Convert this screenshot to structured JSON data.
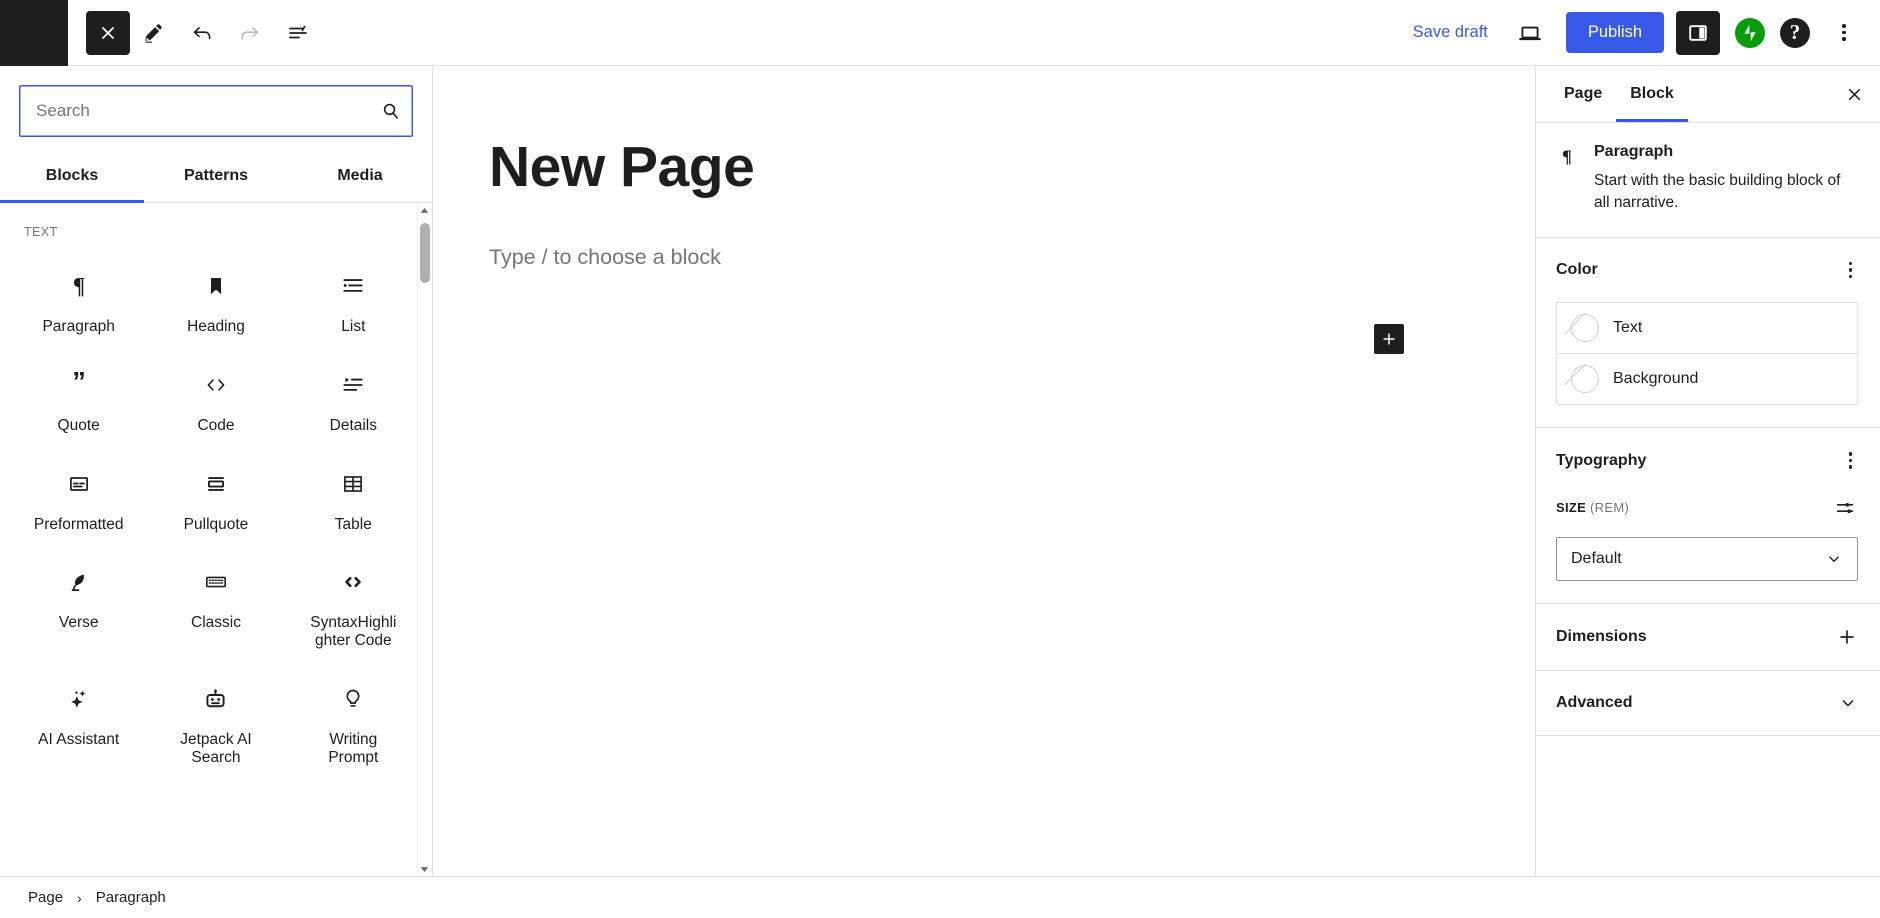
{
  "topbar": {
    "close_icon": "close-x-icon",
    "edit_icon": "pencil-edit-icon",
    "undo_icon": "undo-arrow-icon",
    "redo_icon": "redo-arrow-icon",
    "list_view_icon": "document-list-view-icon",
    "save_draft_label": "Save draft",
    "preview_icon": "desktop-preview-icon",
    "publish_label": "Publish",
    "settings_icon": "settings-sidebar-icon",
    "jetpack_icon": "jetpack-icon",
    "help_icon": "help-question-icon",
    "options_icon": "more-options-kebab-icon"
  },
  "inserter": {
    "search": {
      "value": "",
      "placeholder": "Search",
      "icon": "search-icon"
    },
    "tabs": [
      {
        "label": "Blocks",
        "active": true
      },
      {
        "label": "Patterns",
        "active": false
      },
      {
        "label": "Media",
        "active": false
      }
    ],
    "category_label": "TEXT",
    "blocks": [
      {
        "label": "Paragraph",
        "icon": "pilcrow-icon"
      },
      {
        "label": "Heading",
        "icon": "bookmark-heading-icon"
      },
      {
        "label": "List",
        "icon": "bullet-list-icon"
      },
      {
        "label": "Quote",
        "icon": "quotation-mark-icon"
      },
      {
        "label": "Code",
        "icon": "angle-brackets-icon"
      },
      {
        "label": "Details",
        "icon": "details-disclosure-icon"
      },
      {
        "label": "Preformatted",
        "icon": "preformatted-box-icon"
      },
      {
        "label": "Pullquote",
        "icon": "pullquote-bars-icon"
      },
      {
        "label": "Table",
        "icon": "table-grid-icon"
      },
      {
        "label": "Verse",
        "icon": "feather-quill-icon"
      },
      {
        "label": "Classic",
        "icon": "keyboard-icon"
      },
      {
        "label": "SyntaxHighlighter Code",
        "icon": "angle-brackets-bold-icon"
      },
      {
        "label": "AI Assistant",
        "icon": "sparkles-icon"
      },
      {
        "label": "Jetpack AI Search",
        "icon": "robot-head-icon"
      },
      {
        "label": "Writing Prompt",
        "icon": "lightbulb-icon"
      }
    ]
  },
  "canvas": {
    "page_title": "New Page",
    "block_placeholder": "Type / to choose a block",
    "add_block_icon": "plus-add-block-icon"
  },
  "sidebar": {
    "tabs": [
      {
        "label": "Page",
        "active": false
      },
      {
        "label": "Block",
        "active": true
      }
    ],
    "close_icon": "close-sidebar-icon",
    "block_card": {
      "icon": "pilcrow-icon",
      "title": "Paragraph",
      "description": "Start with the basic building block of all narrative."
    },
    "color_panel": {
      "title": "Color",
      "menu_icon": "more-options-kebab-icon",
      "rows": [
        {
          "label": "Text",
          "swatch": "none-slash-swatch"
        },
        {
          "label": "Background",
          "swatch": "none-slash-swatch"
        }
      ]
    },
    "typography_panel": {
      "title": "Typography",
      "menu_icon": "more-options-kebab-icon",
      "size_label": "SIZE",
      "size_unit": "(REM)",
      "size_toggle_icon": "custom-size-sliders-icon",
      "size_value": "Default",
      "chevron_icon": "chevron-down-icon"
    },
    "dimensions_panel": {
      "title": "Dimensions",
      "icon": "plus-icon"
    },
    "advanced_panel": {
      "title": "Advanced",
      "icon": "chevron-down-icon"
    }
  },
  "footer": {
    "crumbs": [
      "Page",
      "Paragraph"
    ],
    "separator": "›"
  },
  "colors": {
    "accent": "#3858e9",
    "dark": "#1e1e1e",
    "jetpack_green": "#069e08",
    "muted": "#757575",
    "border": "#e0e0e0"
  }
}
